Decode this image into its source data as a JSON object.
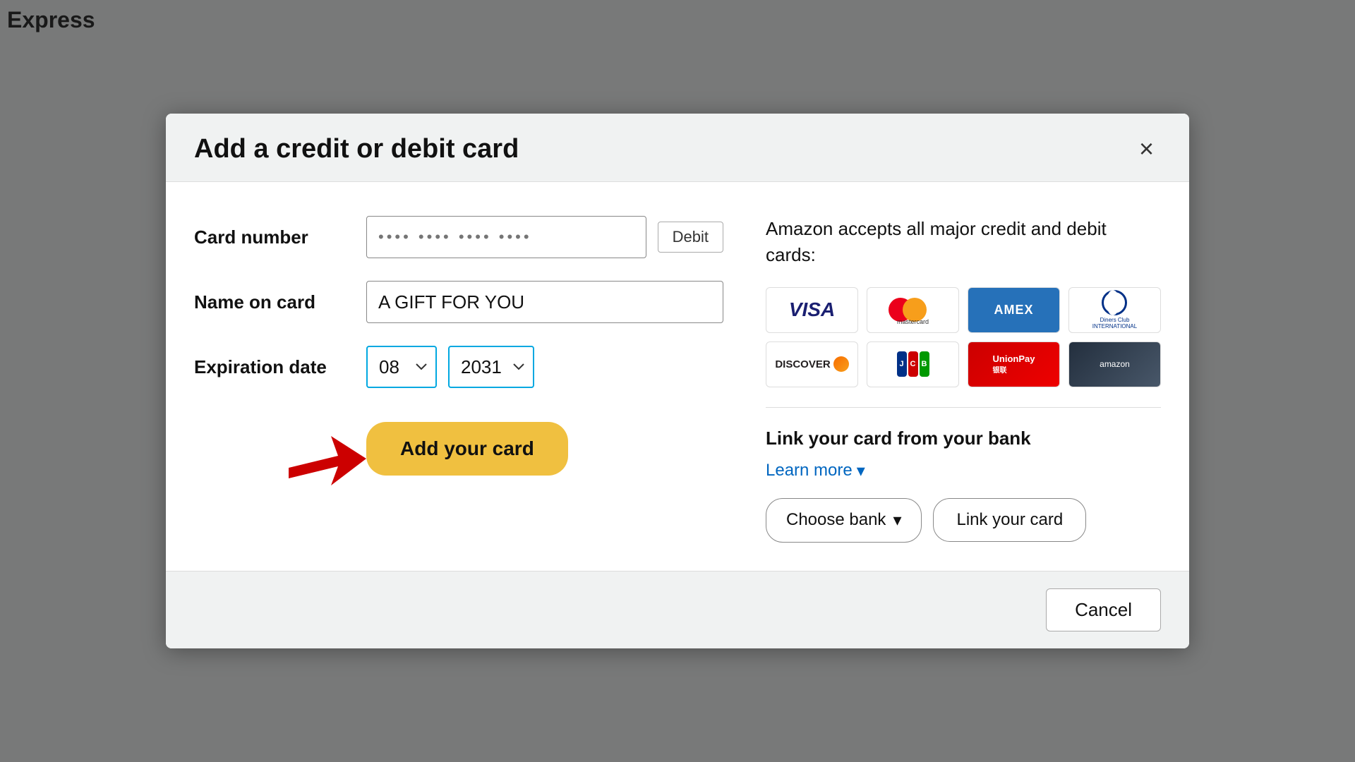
{
  "modal": {
    "title": "Add a credit or debit card",
    "close_label": "×"
  },
  "form": {
    "card_number_label": "Card number",
    "card_number_placeholder": "•••• •••• •••• ••••",
    "debit_badge": "Debit",
    "name_on_card_label": "Name on card",
    "name_on_card_value": "A GIFT FOR YOU",
    "expiration_date_label": "Expiration date",
    "exp_month_value": "08",
    "exp_year_value": "2031",
    "add_card_button": "Add your card"
  },
  "info": {
    "accepted_text": "Amazon accepts all major credit and debit cards:",
    "card_logos": [
      {
        "name": "VISA",
        "type": "visa"
      },
      {
        "name": "Mastercard",
        "type": "mastercard"
      },
      {
        "name": "American Express",
        "type": "amex"
      },
      {
        "name": "Diners Club International",
        "type": "diners"
      },
      {
        "name": "Discover",
        "type": "discover"
      },
      {
        "name": "JCB",
        "type": "jcb"
      },
      {
        "name": "UnionPay",
        "type": "unionpay"
      },
      {
        "name": "Amazon Store Card",
        "type": "amazon"
      }
    ],
    "link_bank_title": "Link your card from your bank",
    "learn_more_label": "Learn more",
    "choose_bank_label": "Choose bank",
    "link_card_label": "Link your card"
  },
  "footer": {
    "cancel_label": "Cancel"
  },
  "background": {
    "page_text": "Express"
  }
}
